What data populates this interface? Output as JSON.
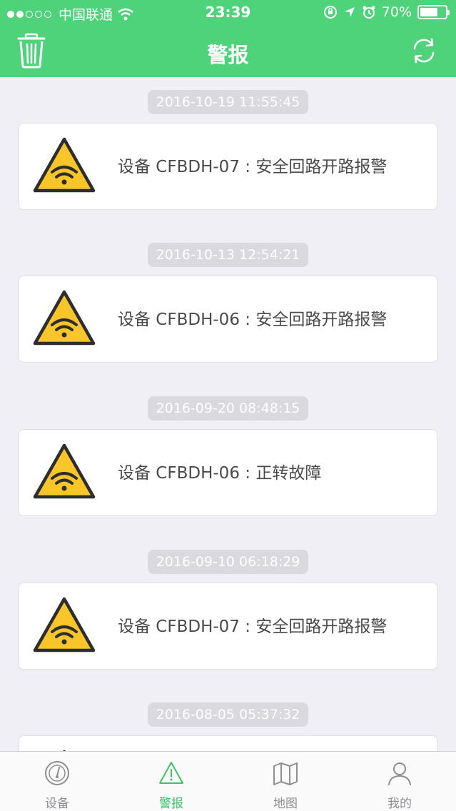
{
  "status_bar": {
    "carrier": "中国联通",
    "time": "23:39",
    "battery": "70%",
    "battery_level": 0.7,
    "icons": [
      "signal-dots",
      "wifi-icon",
      "orientation-lock-icon",
      "location-icon",
      "alarm-icon",
      "battery-icon"
    ]
  },
  "navbar": {
    "title": "警报",
    "left_icon": "trash-icon",
    "right_icon": "refresh-icon"
  },
  "alerts": [
    {
      "time": "2016-10-19 11:55:45",
      "message": "设备 CFBDH-07 : 安全回路开路报警"
    },
    {
      "time": "2016-10-13 12:54:21",
      "message": "设备 CFBDH-06 : 安全回路开路报警"
    },
    {
      "time": "2016-09-20 08:48:15",
      "message": "设备 CFBDH-06 : 正转故障"
    },
    {
      "time": "2016-09-10 06:18:29",
      "message": "设备 CFBDH-07 : 安全回路开路报警"
    },
    {
      "time": "2016-08-05 05:37:32",
      "message": ""
    }
  ],
  "tabs": [
    {
      "label": "设备",
      "icon": "gauge-icon",
      "active": false
    },
    {
      "label": "警报",
      "icon": "warning-icon",
      "active": true
    },
    {
      "label": "地图",
      "icon": "map-icon",
      "active": false
    },
    {
      "label": "我的",
      "icon": "user-icon",
      "active": false
    }
  ],
  "colors": {
    "brand": "#4fd37a",
    "tab_active": "#3cc463",
    "tab_inactive": "#8e8e93",
    "warning_fill": "#f8c52a",
    "background": "#f0eff5"
  }
}
